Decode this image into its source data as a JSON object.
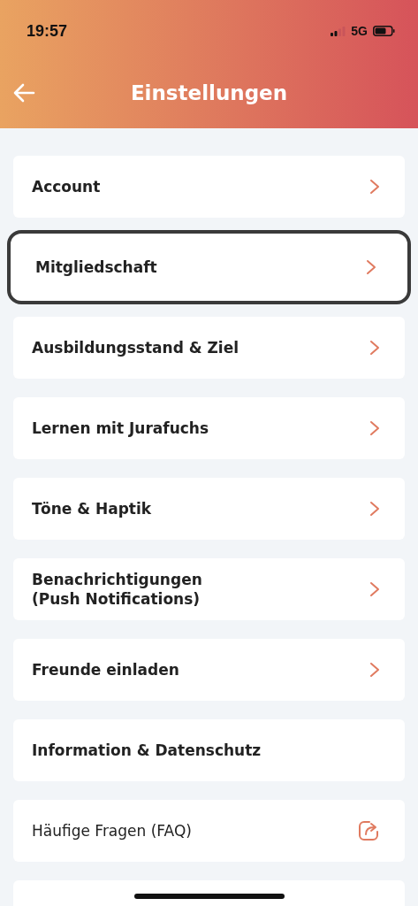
{
  "status_bar": {
    "time": "19:57",
    "network": "5G"
  },
  "header": {
    "title": "Einstellungen"
  },
  "items": [
    {
      "label": "Account",
      "kind": "link",
      "selected": false
    },
    {
      "label": "Mitgliedschaft",
      "kind": "link",
      "selected": true
    },
    {
      "label": "Ausbildungsstand & Ziel",
      "kind": "link",
      "selected": false
    },
    {
      "label": "Lernen mit Jurafuchs",
      "kind": "link",
      "selected": false
    },
    {
      "label": "Töne & Haptik",
      "kind": "link",
      "selected": false
    },
    {
      "label": "Benachrichtigungen\n(Push Notifications)",
      "kind": "link",
      "selected": false
    },
    {
      "label": "Freunde einladen",
      "kind": "link",
      "selected": false
    },
    {
      "label": "Information & Datenschutz",
      "kind": "info",
      "selected": false
    },
    {
      "label": "Häufige Fragen (FAQ)",
      "kind": "external",
      "selected": false
    }
  ]
}
